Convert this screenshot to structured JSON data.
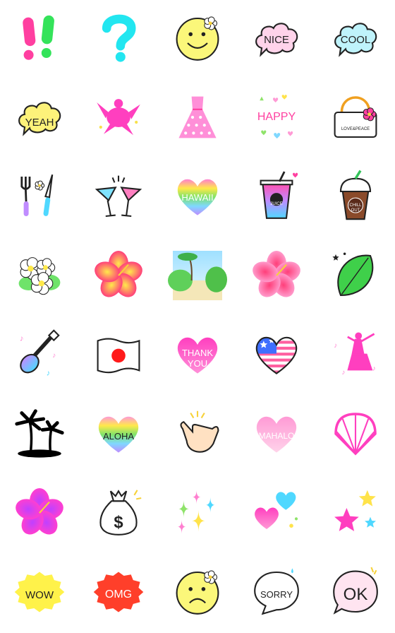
{
  "colors": {
    "pink": "#ff3fa0",
    "cyan": "#22e6f0",
    "green": "#34e35a",
    "yellow": "#fff27a",
    "outline": "#222222"
  },
  "stickers": [
    {
      "icon": "double-exclamation-icon",
      "text": ""
    },
    {
      "icon": "question-mark-icon",
      "text": ""
    },
    {
      "icon": "smiley-flower-icon",
      "text": ""
    },
    {
      "icon": "speech-bubble-nice-icon",
      "text": "NICE"
    },
    {
      "icon": "speech-bubble-cool-icon",
      "text": "COOL"
    },
    {
      "icon": "speech-bubble-yeah-icon",
      "text": "YEAH"
    },
    {
      "icon": "sea-turtle-icon",
      "text": ""
    },
    {
      "icon": "polka-dot-dress-icon",
      "text": ""
    },
    {
      "icon": "happy-hearts-icon",
      "text": "HAPPY"
    },
    {
      "icon": "tote-bag-icon",
      "text": "LOVE&PEACE"
    },
    {
      "icon": "fork-knife-icon",
      "text": ""
    },
    {
      "icon": "cocktail-toast-icon",
      "text": ""
    },
    {
      "icon": "rainbow-heart-hawaii-icon",
      "text": "HAWAII"
    },
    {
      "icon": "juice-cup-icon",
      "text": "JUICE"
    },
    {
      "icon": "chill-out-drink-icon",
      "text": "CHILL OUT"
    },
    {
      "icon": "plumeria-flowers-icon",
      "text": ""
    },
    {
      "icon": "hibiscus-red-icon",
      "text": ""
    },
    {
      "icon": "beach-path-photo-icon",
      "text": ""
    },
    {
      "icon": "hibiscus-pink-icon",
      "text": ""
    },
    {
      "icon": "monstera-leaf-icon",
      "text": ""
    },
    {
      "icon": "ukulele-icon",
      "text": ""
    },
    {
      "icon": "japan-flag-icon",
      "text": ""
    },
    {
      "icon": "heart-thank-you-icon",
      "text": "THANK YOU"
    },
    {
      "icon": "usa-flag-heart-icon",
      "text": ""
    },
    {
      "icon": "hula-dancer-icon",
      "text": ""
    },
    {
      "icon": "palm-island-icon",
      "text": ""
    },
    {
      "icon": "heart-aloha-icon",
      "text": "ALOHA"
    },
    {
      "icon": "shaka-hand-icon",
      "text": ""
    },
    {
      "icon": "heart-mahalo-icon",
      "text": "MAHALO"
    },
    {
      "icon": "seashell-icon",
      "text": ""
    },
    {
      "icon": "hibiscus-magenta-icon",
      "text": ""
    },
    {
      "icon": "money-bag-icon",
      "text": ""
    },
    {
      "icon": "sparkles-icon",
      "text": ""
    },
    {
      "icon": "hearts-icon",
      "text": ""
    },
    {
      "icon": "stars-icon",
      "text": ""
    },
    {
      "icon": "burst-wow-icon",
      "text": "WOW"
    },
    {
      "icon": "burst-omg-icon",
      "text": "OMG"
    },
    {
      "icon": "sad-face-flower-icon",
      "text": ""
    },
    {
      "icon": "speech-bubble-sorry-icon",
      "text": "SORRY"
    },
    {
      "icon": "speech-bubble-ok-icon",
      "text": "OK"
    }
  ]
}
